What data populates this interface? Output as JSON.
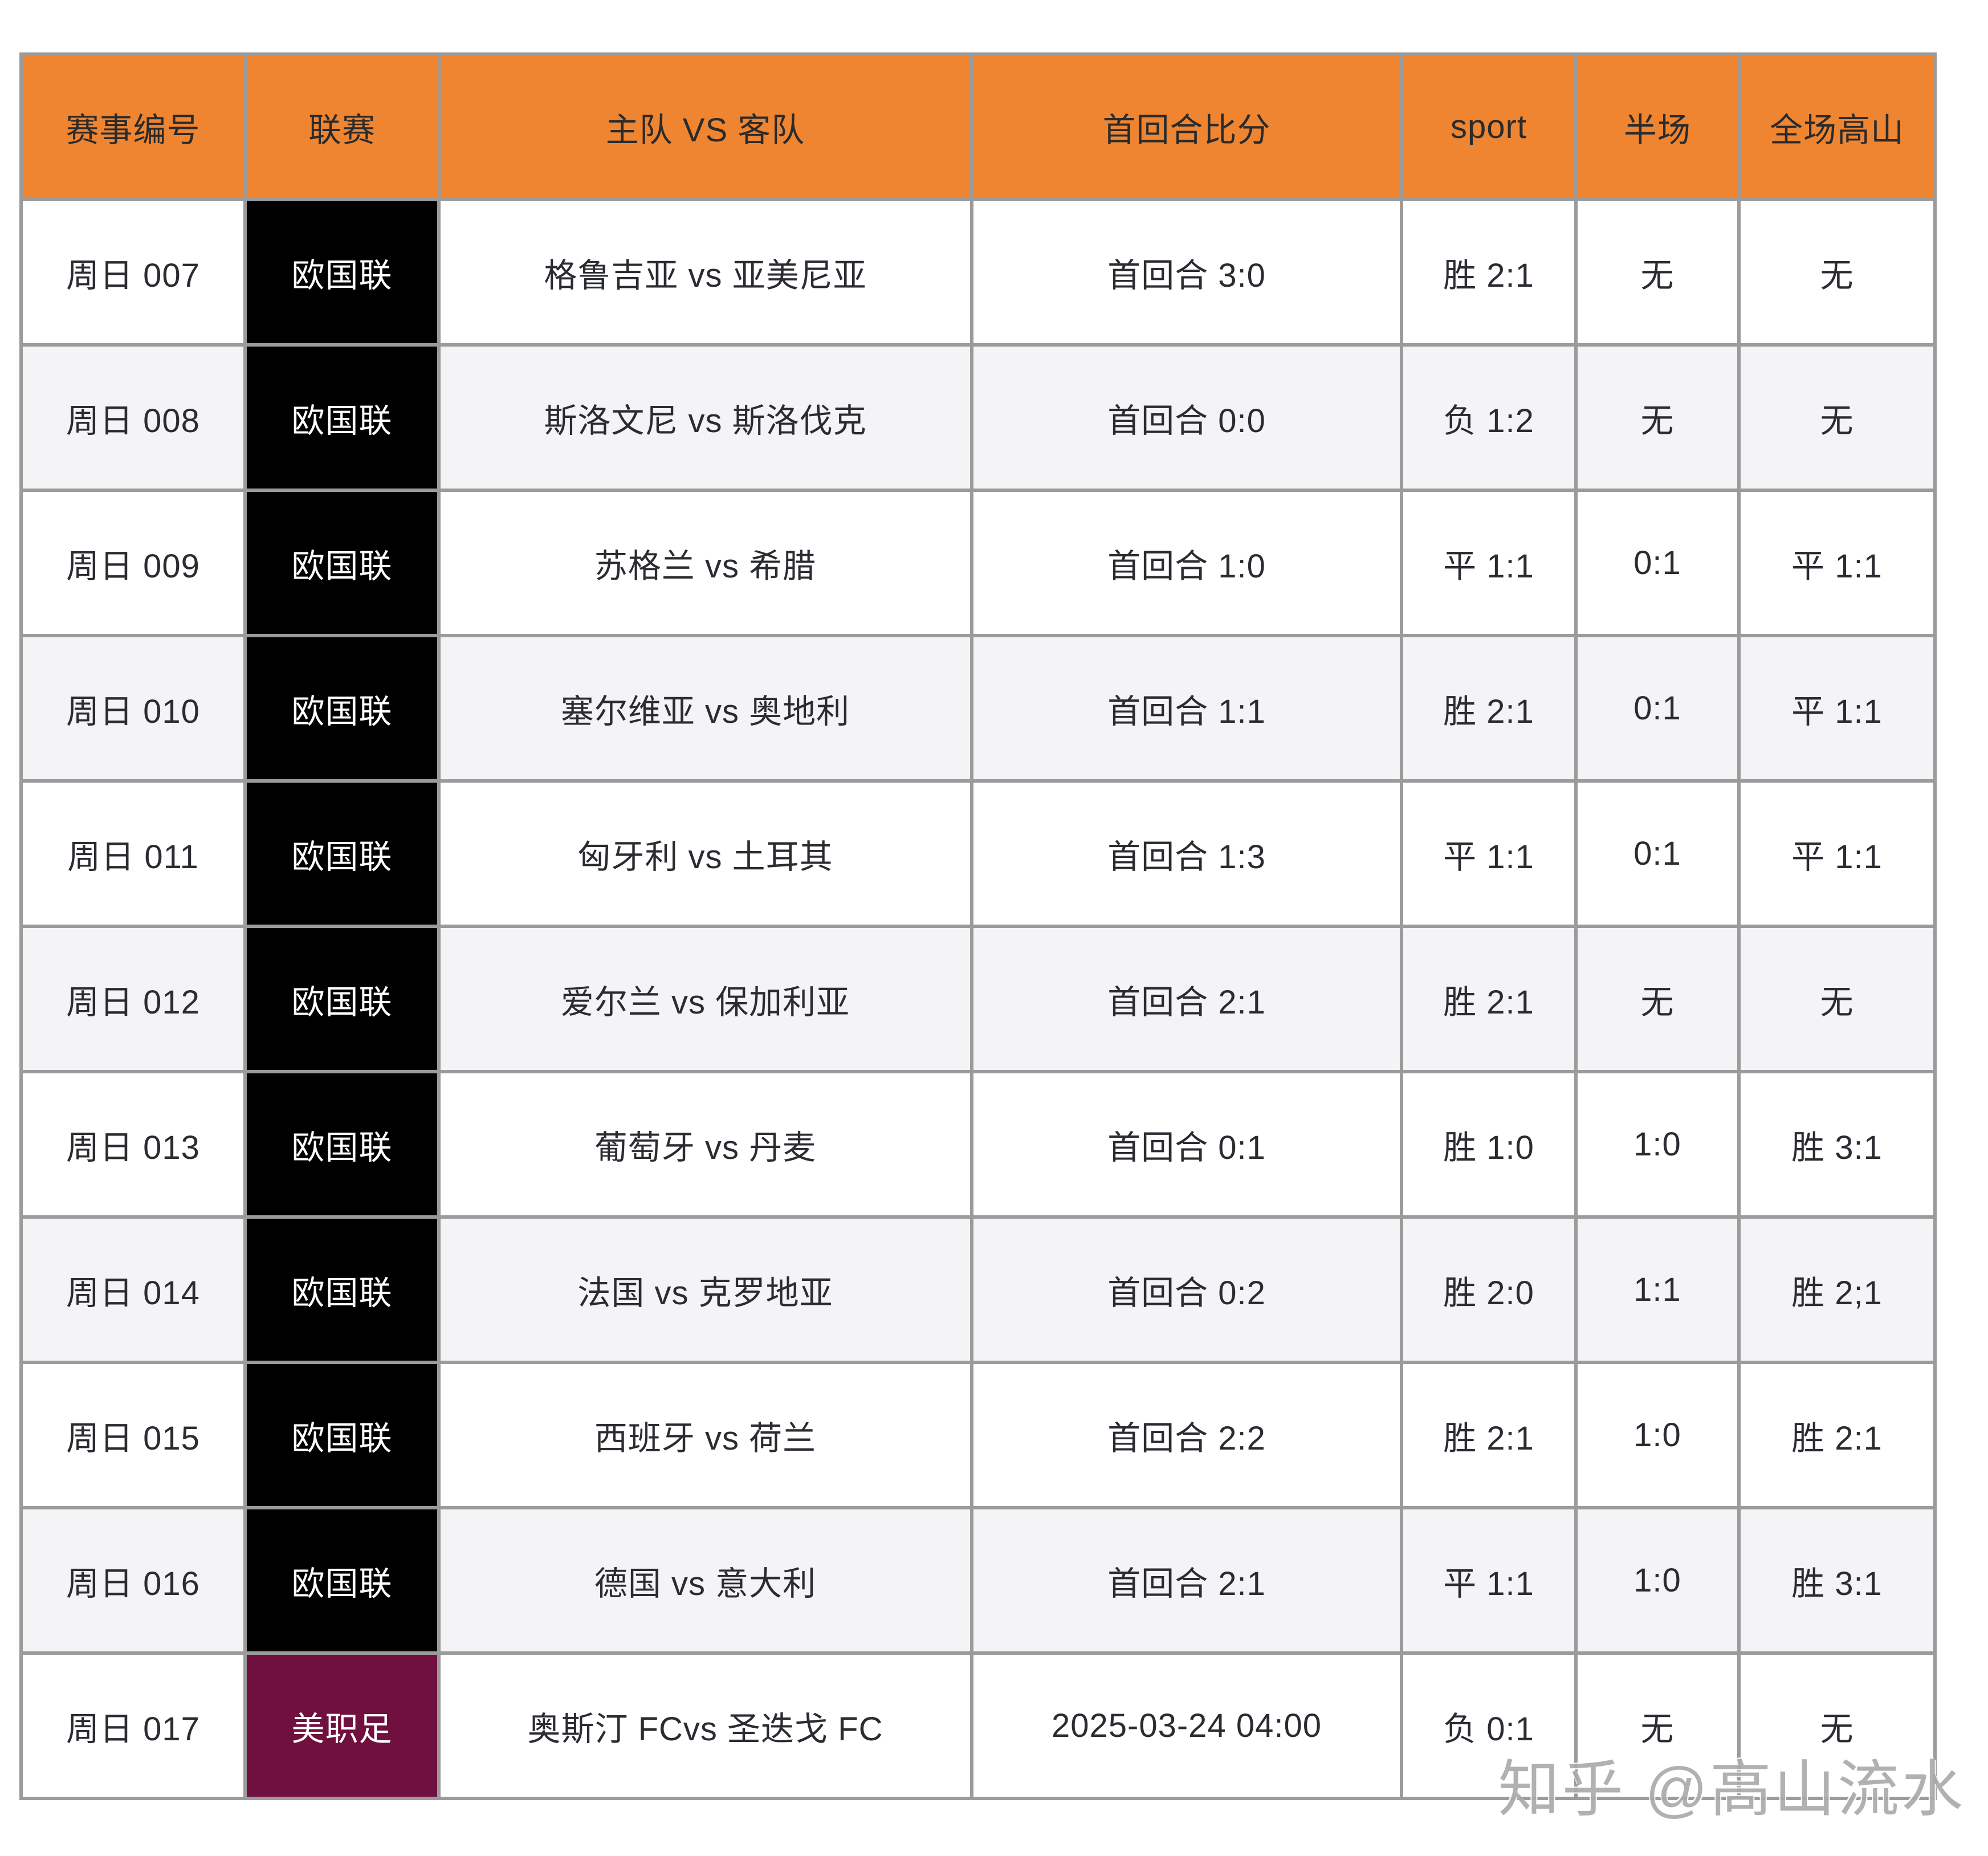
{
  "table": {
    "headers": [
      "赛事编号",
      "联赛",
      "主队 VS 客队",
      "首回合比分",
      "sport",
      "半场",
      "全场高山"
    ],
    "rows": [
      {
        "id": "周日 007",
        "league": "欧国联",
        "league_color": "black",
        "teams": "格鲁吉亚 vs 亚美尼亚",
        "first_leg": "首回合 3:0",
        "sport": "胜 2:1",
        "half": "无",
        "full": "无"
      },
      {
        "id": "周日 008",
        "league": "欧国联",
        "league_color": "black",
        "teams": "斯洛文尼 vs 斯洛伐克",
        "first_leg": "首回合 0:0",
        "sport": "负 1:2",
        "half": "无",
        "full": "无"
      },
      {
        "id": "周日 009",
        "league": "欧国联",
        "league_color": "black",
        "teams": "苏格兰 vs 希腊",
        "first_leg": "首回合 1:0",
        "sport": "平 1:1",
        "half": "0:1",
        "full": "平 1:1"
      },
      {
        "id": "周日 010",
        "league": "欧国联",
        "league_color": "black",
        "teams": "塞尔维亚 vs 奥地利",
        "first_leg": "首回合 1:1",
        "sport": "胜 2:1",
        "half": "0:1",
        "full": "平 1:1"
      },
      {
        "id": "周日 011",
        "league": "欧国联",
        "league_color": "black",
        "teams": "匈牙利 vs 土耳其",
        "first_leg": "首回合 1:3",
        "sport": "平 1:1",
        "half": "0:1",
        "full": "平 1:1"
      },
      {
        "id": "周日 012",
        "league": "欧国联",
        "league_color": "black",
        "teams": "爱尔兰 vs 保加利亚",
        "first_leg": "首回合 2:1",
        "sport": "胜 2:1",
        "half": "无",
        "full": "无"
      },
      {
        "id": "周日 013",
        "league": "欧国联",
        "league_color": "black",
        "teams": "葡萄牙 vs 丹麦",
        "first_leg": "首回合 0:1",
        "sport": "胜 1:0",
        "half": "1:0",
        "full": "胜 3:1"
      },
      {
        "id": "周日 014",
        "league": "欧国联",
        "league_color": "black",
        "teams": "法国 vs 克罗地亚",
        "first_leg": "首回合 0:2",
        "sport": "胜 2:0",
        "half": "1:1",
        "full": "胜 2;1"
      },
      {
        "id": "周日 015",
        "league": "欧国联",
        "league_color": "black",
        "teams": "西班牙 vs 荷兰",
        "first_leg": "首回合 2:2",
        "sport": "胜 2:1",
        "half": "1:0",
        "full": "胜 2:1"
      },
      {
        "id": "周日 016",
        "league": "欧国联",
        "league_color": "black",
        "teams": "德国 vs 意大利",
        "first_leg": "首回合 2:1",
        "sport": "平 1:1",
        "half": "1:0",
        "full": "胜 3:1"
      },
      {
        "id": "周日 017",
        "league": "美职足",
        "league_color": "maroon",
        "teams": "奥斯汀 FCvs 圣迭戈 FC",
        "first_leg": "2025-03-24 04:00",
        "sport": "负 0:1",
        "half": "无",
        "full": "无"
      }
    ]
  },
  "watermark": "知乎 @高山流水",
  "colors": {
    "header_bg": "#EF8531",
    "header_text": "#2B2B2B",
    "cell_text": "#2A2C31",
    "border": "#9B9B9B",
    "row_alt": "#F4F4F6",
    "league_black": "#000000",
    "league_maroon": "#70103E",
    "league_text": "#FFFFFF",
    "watermark": "#ABABAB"
  }
}
